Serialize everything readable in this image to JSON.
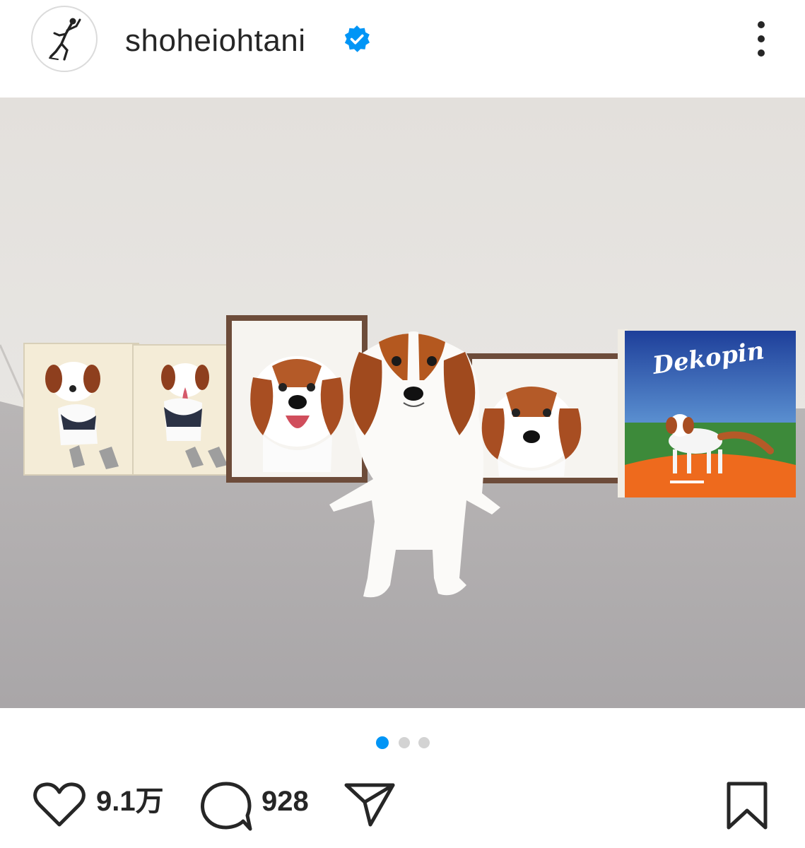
{
  "post": {
    "username": "shoheiohtani",
    "verified": true,
    "accent_color": "#0095f6",
    "artwork_text": "Dekopin",
    "carousel": {
      "total": 3,
      "active_index": 0
    },
    "actions": {
      "like_icon": "heart-icon",
      "likes": "9.1万",
      "comment_icon": "comment-icon",
      "comments": "928",
      "share_icon": "send-icon",
      "save_icon": "bookmark-icon"
    }
  }
}
